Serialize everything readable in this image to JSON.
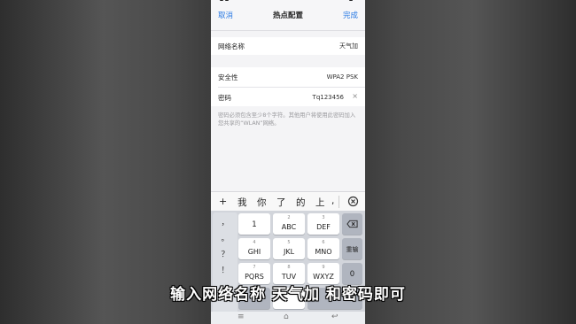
{
  "nav": {
    "cancel": "取消",
    "title": "热点配置",
    "done": "完成"
  },
  "form": {
    "network_name_label": "网络名称",
    "network_name_value": "天气加",
    "security_label": "安全性",
    "security_value": "WPA2 PSK",
    "password_label": "密码",
    "password_value": "Tq123456",
    "clear_icon": "×",
    "hint": "密码必须包含至少8个字符。其他用户将使用此密码加入您共享的“WLAN”网络。"
  },
  "candidates": {
    "plus": "+",
    "items": [
      "我",
      "你",
      "了",
      "的",
      "上",
      ","
    ],
    "delete_icon": "clear-candidate-icon"
  },
  "keyboard": {
    "symbols": [
      "，",
      "。",
      "？",
      "！"
    ],
    "keys": [
      {
        "num": "",
        "label": "1"
      },
      {
        "num": "2",
        "label": "ABC"
      },
      {
        "num": "3",
        "label": "DEF"
      },
      {
        "num": "4",
        "label": "GHI"
      },
      {
        "num": "5",
        "label": "JKL"
      },
      {
        "num": "6",
        "label": "MNO"
      },
      {
        "num": "7",
        "label": "PQRS"
      },
      {
        "num": "8",
        "label": "TUV"
      },
      {
        "num": "9",
        "label": "WXYZ"
      }
    ],
    "func_keys": {
      "delete": "backspace-icon",
      "reinput": "重输",
      "zero": "0"
    }
  },
  "subtitle": "输入网络名称 天气加 和密码即可"
}
